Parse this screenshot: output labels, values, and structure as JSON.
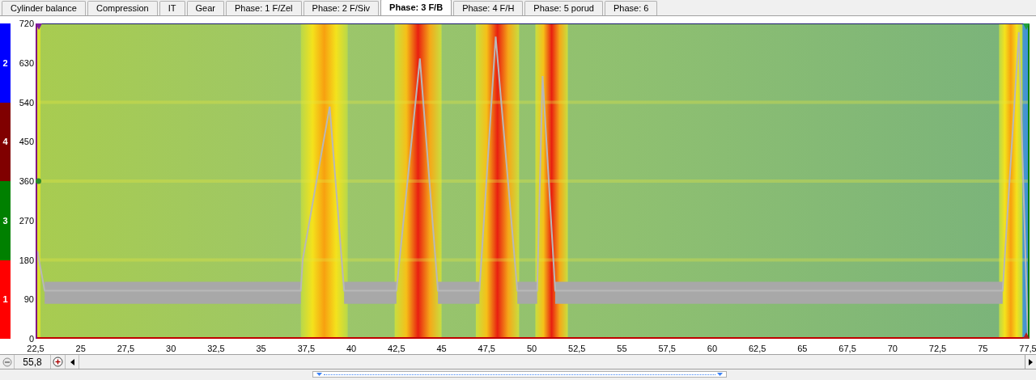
{
  "tabs": [
    {
      "label": "Cylinder balance",
      "selected": false
    },
    {
      "label": "Compression",
      "selected": false
    },
    {
      "label": "IT",
      "selected": false
    },
    {
      "label": "Gear",
      "selected": false
    },
    {
      "label": "Phase: 1 F/Zel",
      "selected": false
    },
    {
      "label": "Phase: 2 F/Siv",
      "selected": false
    },
    {
      "label": "Phase: 3 F/B",
      "selected": true
    },
    {
      "label": "Phase: 4 F/H",
      "selected": false
    },
    {
      "label": "Phase: 5 porud",
      "selected": false
    },
    {
      "label": "Phase: 6",
      "selected": false
    }
  ],
  "cylinders": [
    {
      "label": "2",
      "color": "#0000ff"
    },
    {
      "label": "4",
      "color": "#800000"
    },
    {
      "label": "3",
      "color": "#008000"
    },
    {
      "label": "1",
      "color": "#ff0000"
    }
  ],
  "y_ticks": [
    "720",
    "630",
    "540",
    "450",
    "360",
    "270",
    "180",
    "90",
    "0"
  ],
  "x_ticks": [
    "22,5",
    "25",
    "27,5",
    "30",
    "32,5",
    "35",
    "37,5",
    "40",
    "42,5",
    "45",
    "47,5",
    "50",
    "52,5",
    "55",
    "57,5",
    "60",
    "62,5",
    "65",
    "67,5",
    "70",
    "72,5",
    "75",
    "77,5"
  ],
  "zoom": {
    "value": "55,8"
  }
}
